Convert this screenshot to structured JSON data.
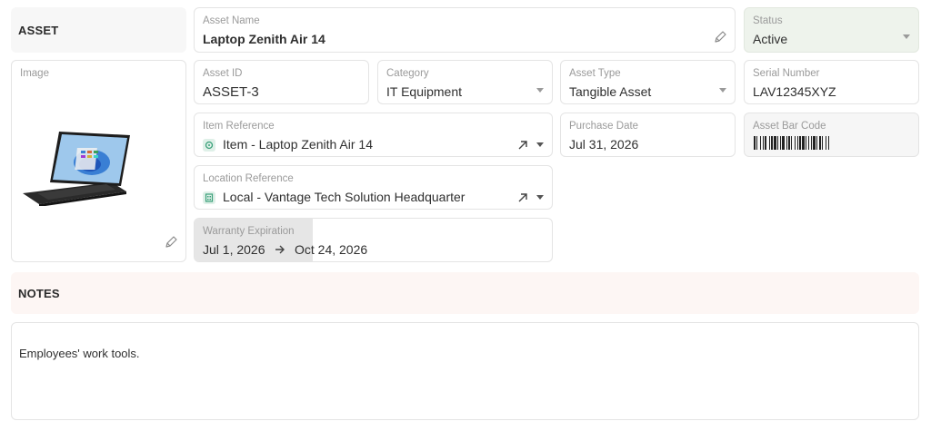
{
  "asset_section": {
    "title": "ASSET"
  },
  "asset_name": {
    "label": "Asset Name",
    "value": "Laptop Zenith Air 14"
  },
  "status": {
    "label": "Status",
    "value": "Active"
  },
  "image": {
    "label": "Image"
  },
  "asset_id": {
    "label": "Asset ID",
    "value": "ASSET-3"
  },
  "category": {
    "label": "Category",
    "value": "IT Equipment"
  },
  "asset_type": {
    "label": "Asset Type",
    "value": "Tangible Asset"
  },
  "serial_number": {
    "label": "Serial Number",
    "value": "LAV12345XYZ"
  },
  "item_reference": {
    "label": "Item Reference",
    "value": "Item - Laptop Zenith Air 14"
  },
  "purchase_date": {
    "label": "Purchase Date",
    "value": "Jul 31, 2026"
  },
  "asset_bar_code": {
    "label": "Asset Bar Code"
  },
  "location_reference": {
    "label": "Location Reference",
    "value": "Local - Vantage Tech Solution Headquarter"
  },
  "warranty": {
    "label": "Warranty Expiration",
    "start": "Jul 1, 2026",
    "end": "Oct 24, 2026"
  },
  "notes_section": {
    "title": "NOTES"
  },
  "notes": {
    "value": "Employees' work tools."
  },
  "colors": {
    "status_bg": "#eef3ec",
    "asset_header_bg": "#f7f7f7",
    "notes_header_bg": "#fdf6f4",
    "warranty_highlight": "#e6e6e6",
    "item_icon": "#3aa07a"
  },
  "icons": {
    "edit": "pencil-icon",
    "open_link": "arrow-up-right-icon",
    "dropdown": "chevron-down-icon",
    "range": "arrow-right-icon",
    "item": "box-icon",
    "location": "building-icon"
  }
}
